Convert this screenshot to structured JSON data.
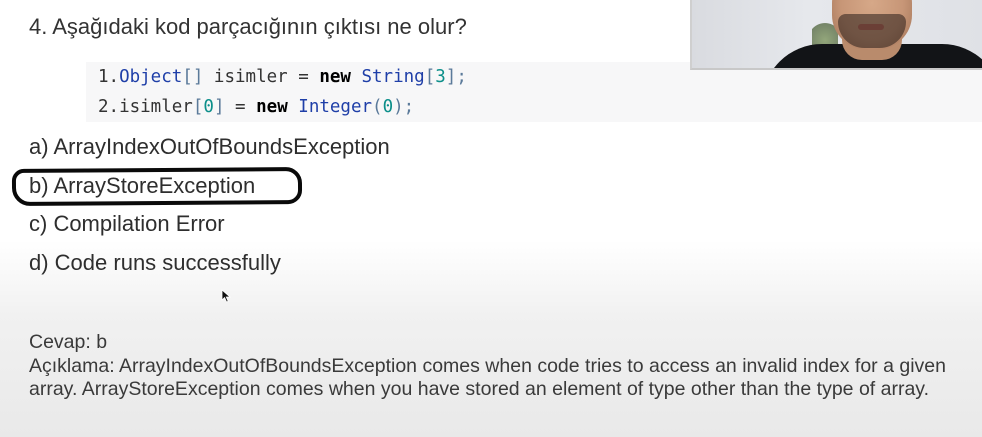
{
  "question": {
    "text": "4. Aşağıdaki kod parçacığının çıktısı ne olur?"
  },
  "code": {
    "line1": {
      "number": "1.",
      "type": "Object",
      "brackets": "[]",
      "identifier": "isimler",
      "operator": "=",
      "keyword": "new",
      "ctor": "String",
      "open": "[",
      "size": "3",
      "close": "];"
    },
    "line2": {
      "number": "2.",
      "identifier": "isimler",
      "open": "[",
      "index": "0",
      "close": "]",
      "operator": "=",
      "keyword": "new",
      "ctor": "Integer",
      "popen": "(",
      "arg": "0",
      "pclose": ");"
    }
  },
  "options": [
    {
      "label": "a) ArrayIndexOutOfBoundsException"
    },
    {
      "label": "b) ArrayStoreException"
    },
    {
      "label": "c) Compilation Error"
    },
    {
      "label": "d) Code runs successfully"
    }
  ],
  "answer": {
    "text": "Cevap: b"
  },
  "explanation": {
    "text": "Açıklama: ArrayIndexOutOfBoundsException comes when code tries to access an invalid index for a given array. ArrayStoreException comes when you have stored an element of type other than the type of array."
  },
  "colors": {
    "code_type": "#1f3fa8",
    "code_number": "#0c8f8a",
    "code_keyword": "#000000",
    "highlight_ring": "#0a0a0a"
  },
  "icons": {
    "cursor": "mouse-pointer-icon"
  }
}
